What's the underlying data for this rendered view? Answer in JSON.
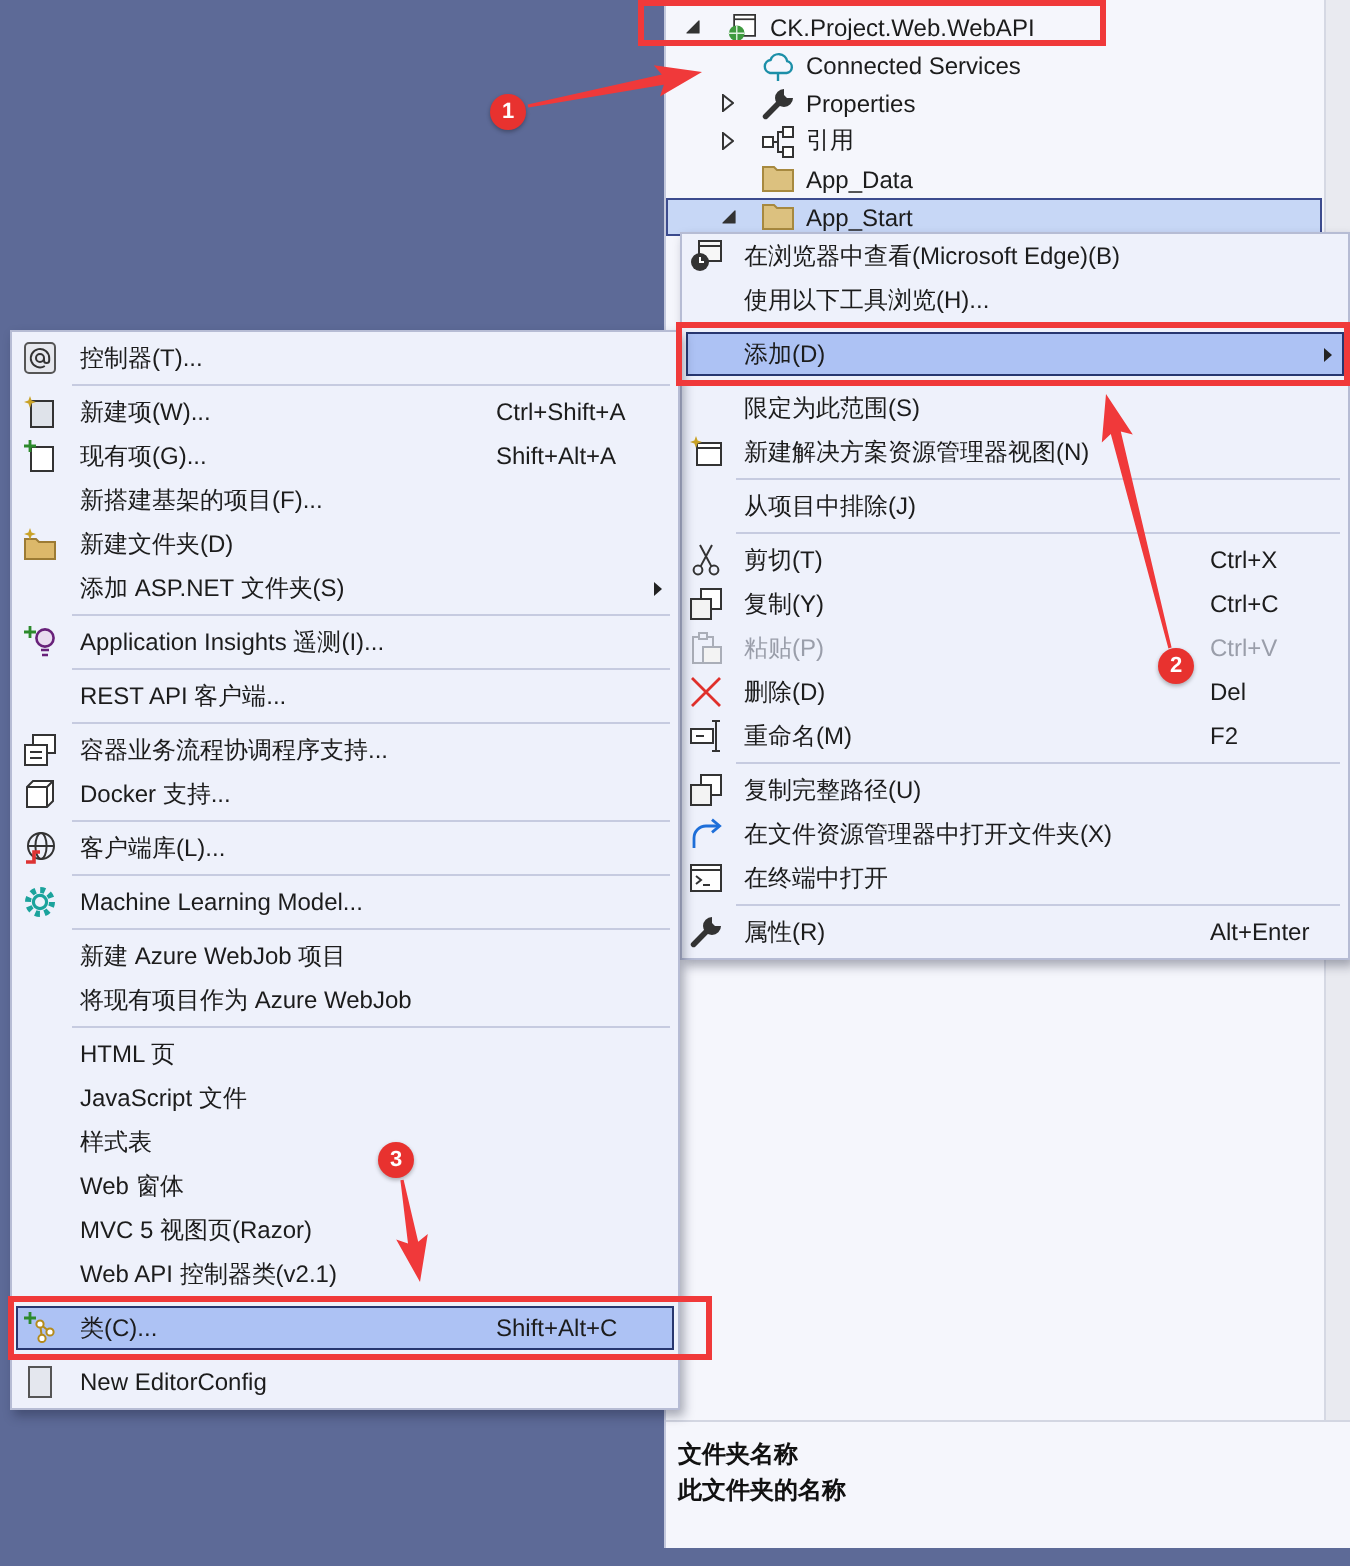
{
  "solution_explorer": {
    "tree": [
      {
        "label": "CK.Project.Web.WebAPI",
        "expanded": true,
        "selected": false,
        "children": [
          {
            "label": "Connected Services",
            "selected": false
          },
          {
            "label": "Properties",
            "expanded": false,
            "selected": false
          },
          {
            "label": "引用",
            "expanded": false,
            "selected": false
          },
          {
            "label": "App_Data",
            "selected": false
          },
          {
            "label": "App_Start",
            "expanded": true,
            "selected": true
          }
        ]
      }
    ],
    "properties_pane": {
      "name": "文件夹名称",
      "description": "此文件夹的名称"
    }
  },
  "context_menu": {
    "items": [
      {
        "kind": "command",
        "label": "在浏览器中查看(Microsoft Edge)(B)",
        "selected": false,
        "disabled": false,
        "submenu": false
      },
      {
        "kind": "command",
        "label": "使用以下工具浏览(H)...",
        "selected": false,
        "disabled": false,
        "submenu": false
      },
      {
        "kind": "separator"
      },
      {
        "kind": "command",
        "label": "添加(D)",
        "selected": true,
        "disabled": false,
        "submenu": true
      },
      {
        "kind": "separator"
      },
      {
        "kind": "command",
        "label": "限定为此范围(S)",
        "selected": false,
        "disabled": false,
        "submenu": false
      },
      {
        "kind": "command",
        "label": "新建解决方案资源管理器视图(N)",
        "selected": false,
        "disabled": false,
        "submenu": false
      },
      {
        "kind": "separator"
      },
      {
        "kind": "command",
        "label": "从项目中排除(J)",
        "selected": false,
        "disabled": false,
        "submenu": false
      },
      {
        "kind": "separator"
      },
      {
        "kind": "command",
        "label": "剪切(T)",
        "shortcut": "Ctrl+X",
        "selected": false,
        "disabled": false,
        "submenu": false
      },
      {
        "kind": "command",
        "label": "复制(Y)",
        "shortcut": "Ctrl+C",
        "selected": false,
        "disabled": false,
        "submenu": false
      },
      {
        "kind": "command",
        "label": "粘贴(P)",
        "shortcut": "Ctrl+V",
        "selected": false,
        "disabled": true,
        "submenu": false
      },
      {
        "kind": "command",
        "label": "删除(D)",
        "shortcut": "Del",
        "selected": false,
        "disabled": false,
        "submenu": false
      },
      {
        "kind": "command",
        "label": "重命名(M)",
        "shortcut": "F2",
        "selected": false,
        "disabled": false,
        "submenu": false
      },
      {
        "kind": "separator"
      },
      {
        "kind": "command",
        "label": "复制完整路径(U)",
        "selected": false,
        "disabled": false,
        "submenu": false
      },
      {
        "kind": "command",
        "label": "在文件资源管理器中打开文件夹(X)",
        "selected": false,
        "disabled": false,
        "submenu": false
      },
      {
        "kind": "command",
        "label": "在终端中打开",
        "selected": false,
        "disabled": false,
        "submenu": false
      },
      {
        "kind": "separator"
      },
      {
        "kind": "command",
        "label": "属性(R)",
        "shortcut": "Alt+Enter",
        "selected": false,
        "disabled": false,
        "submenu": false
      }
    ]
  },
  "add_submenu": {
    "items": [
      {
        "kind": "command",
        "label": "控制器(T)...",
        "selected": false,
        "disabled": false,
        "submenu": false
      },
      {
        "kind": "separator"
      },
      {
        "kind": "command",
        "label": "新建项(W)...",
        "shortcut": "Ctrl+Shift+A",
        "selected": false,
        "disabled": false,
        "submenu": false
      },
      {
        "kind": "command",
        "label": "现有项(G)...",
        "shortcut": "Shift+Alt+A",
        "selected": false,
        "disabled": false,
        "submenu": false
      },
      {
        "kind": "command",
        "label": "新搭建基架的项目(F)...",
        "selected": false,
        "disabled": false,
        "submenu": false
      },
      {
        "kind": "command",
        "label": "新建文件夹(D)",
        "selected": false,
        "disabled": false,
        "submenu": false
      },
      {
        "kind": "command",
        "label": "添加 ASP.NET 文件夹(S)",
        "selected": false,
        "disabled": false,
        "submenu": true
      },
      {
        "kind": "separator"
      },
      {
        "kind": "command",
        "label": "Application Insights 遥测(I)...",
        "selected": false,
        "disabled": false,
        "submenu": false
      },
      {
        "kind": "separator"
      },
      {
        "kind": "command",
        "label": "REST API 客户端...",
        "selected": false,
        "disabled": false,
        "submenu": false
      },
      {
        "kind": "separator"
      },
      {
        "kind": "command",
        "label": "容器业务流程协调程序支持...",
        "selected": false,
        "disabled": false,
        "submenu": false
      },
      {
        "kind": "command",
        "label": "Docker 支持...",
        "selected": false,
        "disabled": false,
        "submenu": false
      },
      {
        "kind": "separator"
      },
      {
        "kind": "command",
        "label": "客户端库(L)...",
        "selected": false,
        "disabled": false,
        "submenu": false
      },
      {
        "kind": "separator"
      },
      {
        "kind": "command",
        "label": "Machine Learning Model...",
        "selected": false,
        "disabled": false,
        "submenu": false
      },
      {
        "kind": "separator"
      },
      {
        "kind": "command",
        "label": "新建 Azure WebJob 项目",
        "selected": false,
        "disabled": false,
        "submenu": false
      },
      {
        "kind": "command",
        "label": "将现有项目作为 Azure WebJob",
        "selected": false,
        "disabled": false,
        "submenu": false
      },
      {
        "kind": "separator"
      },
      {
        "kind": "command",
        "label": "HTML 页",
        "selected": false,
        "disabled": false,
        "submenu": false
      },
      {
        "kind": "command",
        "label": "JavaScript 文件",
        "selected": false,
        "disabled": false,
        "submenu": false
      },
      {
        "kind": "command",
        "label": "样式表",
        "selected": false,
        "disabled": false,
        "submenu": false
      },
      {
        "kind": "command",
        "label": "Web 窗体",
        "selected": false,
        "disabled": false,
        "submenu": false
      },
      {
        "kind": "command",
        "label": "MVC 5 视图页(Razor)",
        "selected": false,
        "disabled": false,
        "submenu": false
      },
      {
        "kind": "command",
        "label": "Web API 控制器类(v2.1)",
        "selected": false,
        "disabled": false,
        "submenu": false
      },
      {
        "kind": "separator"
      },
      {
        "kind": "command",
        "label": "类(C)...",
        "shortcut": "Shift+Alt+C",
        "selected": true,
        "disabled": false,
        "submenu": false
      },
      {
        "kind": "separator"
      },
      {
        "kind": "command",
        "label": "New EditorConfig",
        "selected": false,
        "disabled": false,
        "submenu": false
      }
    ]
  },
  "annotations": [
    {
      "number": "1"
    },
    {
      "number": "2"
    },
    {
      "number": "3"
    }
  ]
}
